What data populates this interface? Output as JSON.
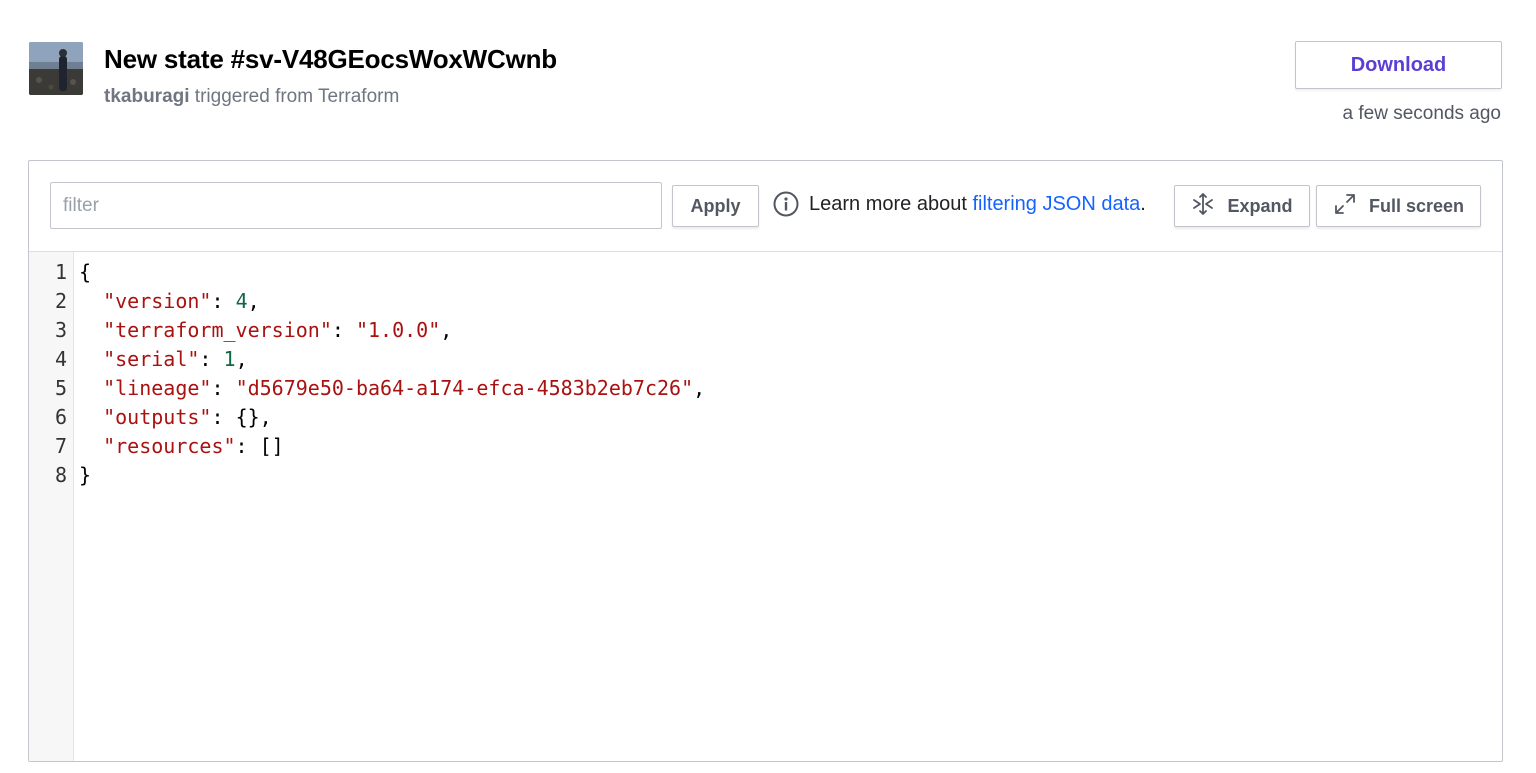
{
  "header": {
    "title": "New state #sv-V48GEocsWoxWCwnb",
    "user": "tkaburagi",
    "trigger_text": " triggered from Terraform",
    "download_label": "Download",
    "timestamp": "a few seconds ago"
  },
  "toolbar": {
    "filter_placeholder": "filter",
    "apply_label": "Apply",
    "learn_prefix": "Learn more about ",
    "learn_link": "filtering JSON data",
    "learn_suffix": ".",
    "expand_label": "Expand",
    "fullscreen_label": "Full screen"
  },
  "code": {
    "line_numbers": [
      "1",
      "2",
      "3",
      "4",
      "5",
      "6",
      "7",
      "8"
    ],
    "l1": {
      "text": "{"
    },
    "l2": {
      "key": "\"version\"",
      "sep": ": ",
      "val": "4",
      "end": ","
    },
    "l3": {
      "key": "\"terraform_version\"",
      "sep": ": ",
      "val": "\"1.0.0\"",
      "end": ","
    },
    "l4": {
      "key": "\"serial\"",
      "sep": ": ",
      "val": "1",
      "end": ","
    },
    "l5": {
      "key": "\"lineage\"",
      "sep": ": ",
      "val": "\"d5679e50-ba64-a174-efca-4583b2eb7c26\"",
      "end": ","
    },
    "l6": {
      "key": "\"outputs\"",
      "sep": ": ",
      "val": "{}",
      "end": ","
    },
    "l7": {
      "key": "\"resources\"",
      "sep": ": ",
      "val": "[]",
      "end": ""
    },
    "l8": {
      "text": "}"
    }
  },
  "colors": {
    "accent": "#5b3ed6",
    "link": "#1563ff",
    "json_string": "#aa1111",
    "json_number": "#116644"
  }
}
